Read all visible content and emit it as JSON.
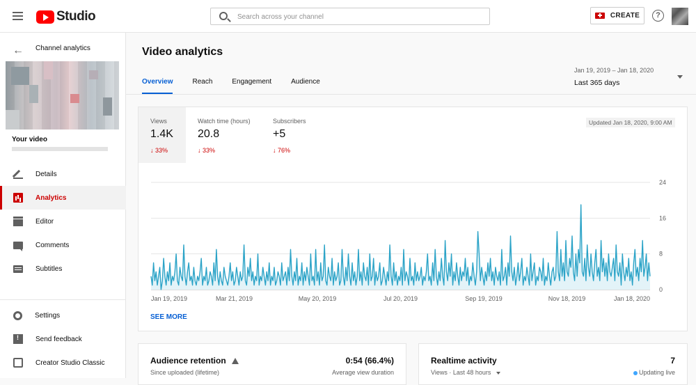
{
  "header": {
    "logo_text": "Studio",
    "search_placeholder": "Search across your channel",
    "create_label": "CREATE",
    "help_symbol": "?"
  },
  "sidebar": {
    "back_title": "Channel analytics",
    "video_label": "Your video",
    "items": [
      {
        "label": "Details",
        "icon": "pencil-icon"
      },
      {
        "label": "Analytics",
        "icon": "analytics-icon",
        "active": true
      },
      {
        "label": "Editor",
        "icon": "clapperboard-icon"
      },
      {
        "label": "Comments",
        "icon": "comment-icon"
      },
      {
        "label": "Subtitles",
        "icon": "subtitles-icon"
      }
    ],
    "bottom_items": [
      {
        "label": "Settings",
        "icon": "gear-icon"
      },
      {
        "label": "Send feedback",
        "icon": "feedback-icon"
      },
      {
        "label": "Creator Studio Classic",
        "icon": "classic-icon"
      }
    ]
  },
  "main": {
    "title": "Video analytics",
    "tabs": [
      "Overview",
      "Reach",
      "Engagement",
      "Audience"
    ],
    "active_tab": "Overview",
    "date_range": {
      "sub": "Jan 19, 2019 – Jan 18, 2020",
      "main": "Last 365 days"
    }
  },
  "overview": {
    "metrics": [
      {
        "label": "Views",
        "value": "1.4K",
        "change": "↓ 33%"
      },
      {
        "label": "Watch time (hours)",
        "value": "20.8",
        "change": "↓ 33%"
      },
      {
        "label": "Subscribers",
        "value": "+5",
        "change": "↓ 76%"
      }
    ],
    "updated": "Updated Jan 18, 2020, 9:00 AM",
    "see_more": "SEE MORE"
  },
  "chart_data": {
    "type": "area",
    "x_tick_labels": [
      "Jan 19, 2019",
      "Mar 21, 2019",
      "May 20, 2019",
      "Jul 20, 2019",
      "Sep 19, 2019",
      "Nov 18, 2019",
      "Jan 18, 2020"
    ],
    "y_ticks": [
      0,
      8,
      16,
      24
    ],
    "ylim": [
      0,
      24
    ],
    "grid": true,
    "color": "#2ba3c7",
    "fill": "#e3f3f8",
    "values": [
      3,
      1,
      6,
      2,
      4,
      1,
      3,
      5,
      0,
      2,
      7,
      3,
      1,
      4,
      2,
      6,
      1,
      3,
      2,
      4,
      8,
      2,
      1,
      5,
      3,
      2,
      10,
      3,
      1,
      4,
      6,
      2,
      3,
      1,
      5,
      2,
      1,
      3,
      2,
      4,
      7,
      1,
      3,
      2,
      5,
      1,
      2,
      4,
      3,
      1,
      6,
      2,
      9,
      3,
      1,
      4,
      2,
      1,
      5,
      3,
      2,
      1,
      3,
      6,
      2,
      4,
      1,
      2,
      5,
      3,
      1,
      4,
      2,
      3,
      10,
      2,
      1,
      5,
      3,
      7,
      2,
      4,
      1,
      3,
      2,
      8,
      1,
      3,
      2,
      5,
      3,
      1,
      4,
      2,
      6,
      1,
      3,
      2,
      5,
      1,
      2,
      4,
      3,
      1,
      6,
      2,
      3,
      4,
      1,
      5,
      2,
      9,
      3,
      1,
      4,
      2,
      7,
      1,
      3,
      2,
      6,
      1,
      4,
      2,
      5,
      3,
      1,
      8,
      2,
      3,
      1,
      9,
      2,
      4,
      1,
      6,
      2,
      3,
      10,
      2,
      1,
      5,
      3,
      2,
      7,
      1,
      4,
      2,
      3,
      6,
      1,
      2,
      9,
      3,
      1,
      5,
      2,
      8,
      3,
      1,
      6,
      2,
      4,
      1,
      3,
      9,
      2,
      4,
      1,
      6,
      3,
      2,
      5,
      1,
      8,
      2,
      3,
      7,
      1,
      4,
      2,
      3,
      6,
      1,
      2,
      5,
      3,
      1,
      4,
      2,
      10,
      3,
      1,
      6,
      2,
      4,
      1,
      3,
      2,
      5,
      1,
      9,
      2,
      4,
      3,
      1,
      7,
      2,
      3,
      1,
      6,
      2,
      4,
      2,
      3,
      5,
      1,
      3,
      2,
      4,
      8,
      2,
      3,
      1,
      6,
      2,
      9,
      3,
      1,
      4,
      2,
      7,
      3,
      1,
      11,
      4,
      2,
      6,
      3,
      8,
      1,
      4,
      2,
      6,
      3,
      1,
      5,
      2,
      4,
      3,
      7,
      2,
      5,
      1,
      3,
      2,
      6,
      3,
      1,
      4,
      13,
      8,
      2,
      5,
      3,
      1,
      4,
      2,
      6,
      3,
      7,
      2,
      4,
      1,
      5,
      3,
      2,
      4,
      1,
      9,
      2,
      3,
      5,
      1,
      6,
      3,
      12,
      4,
      2,
      5,
      1,
      3,
      6,
      2,
      4,
      7,
      1,
      3,
      2,
      5,
      3,
      1,
      8,
      2,
      4,
      6,
      1,
      3,
      2,
      5,
      4,
      2,
      7,
      1,
      3,
      2,
      6,
      3,
      1,
      4,
      5,
      2,
      3,
      13,
      4,
      2,
      9,
      3,
      6,
      2,
      11,
      4,
      3,
      7,
      5,
      12,
      4,
      2,
      8,
      3,
      9,
      6,
      19,
      4,
      3,
      7,
      2,
      10,
      5,
      3,
      8,
      4,
      2,
      6,
      9,
      3,
      5,
      2,
      11,
      4,
      7,
      3,
      6,
      2,
      8,
      4,
      3,
      5,
      7,
      2,
      10,
      4,
      3,
      6,
      1,
      8,
      4,
      2,
      5,
      3,
      7,
      2,
      4,
      1,
      6,
      9,
      3,
      5,
      2,
      7,
      4,
      11,
      3,
      5,
      8,
      2,
      6,
      3
    ]
  },
  "bottom_cards": {
    "retention": {
      "title": "Audience retention",
      "sub": "Since uploaded (lifetime)",
      "value": "0:54 (66.4%)",
      "value_sub": "Average view duration"
    },
    "realtime": {
      "title": "Realtime activity",
      "sub": "Views · Last 48 hours",
      "value": "7",
      "value_sub": "Updating live"
    }
  }
}
